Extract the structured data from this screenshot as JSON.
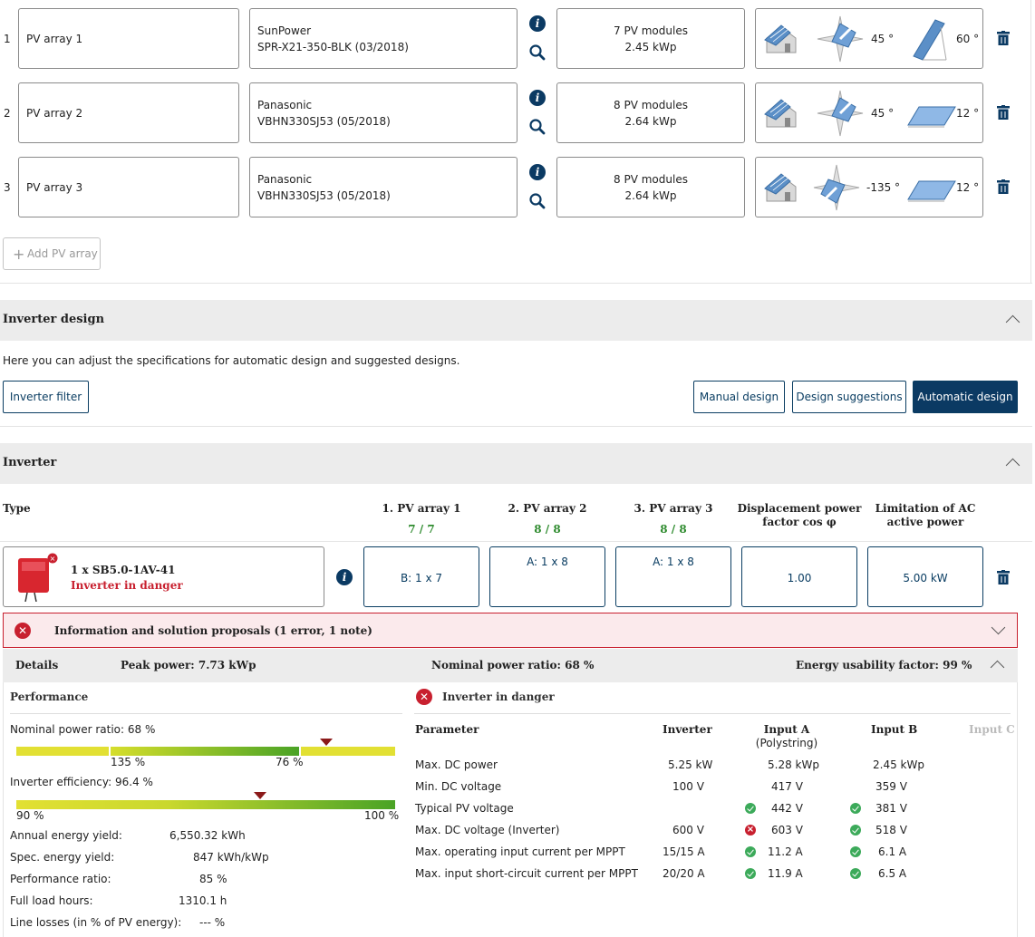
{
  "pv_arrays": [
    {
      "index": "1",
      "name": "PV array 1",
      "manufacturer": "SunPower",
      "model": "SPR-X21-350-BLK (03/2018)",
      "modules": "7 PV modules",
      "power": "2.45 kWp",
      "azimuth": "45 °",
      "tilt": "60 °"
    },
    {
      "index": "2",
      "name": "PV array 2",
      "manufacturer": "Panasonic",
      "model": "VBHN330SJ53 (05/2018)",
      "modules": "8 PV modules",
      "power": "2.64 kWp",
      "azimuth": "45 °",
      "tilt": "12 °"
    },
    {
      "index": "3",
      "name": "PV array 3",
      "manufacturer": "Panasonic",
      "model": "VBHN330SJ53 (05/2018)",
      "modules": "8 PV modules",
      "power": "2.64 kWp",
      "azimuth": "-135 °",
      "tilt": "12 °"
    }
  ],
  "add_pv_array_label": "Add PV array",
  "inverter_design": {
    "title": "Inverter design",
    "description": "Here you can adjust the specifications for automatic design and suggested designs.",
    "filter_label": "Inverter filter",
    "manual_label": "Manual design",
    "suggestions_label": "Design suggestions",
    "automatic_label": "Automatic design"
  },
  "inverter": {
    "title": "Inverter",
    "col_type": "Type",
    "col_pv1": "1. PV array 1",
    "col_pv2": "2. PV array 2",
    "col_pv3": "3. PV array 3",
    "pv1_count": "7 / 7",
    "pv2_count": "8 / 8",
    "pv3_count": "8 / 8",
    "col_cosphi_line1": "Displacement power",
    "col_cosphi_line2": "factor cos φ",
    "col_limit_line1": "Limitation of AC",
    "col_limit_line2": "active power",
    "model": "1 x SB5.0-1AV-41",
    "status": "Inverter in danger",
    "pv1_config": "B: 1 x 7",
    "pv2_config": "A: 1 x 8",
    "pv3_config": "A: 1 x 8",
    "cosphi": "1.00",
    "limit": "5.00 kW"
  },
  "info_panel": {
    "label": "Information and solution proposals (1 error, 1 note)"
  },
  "details": {
    "label": "Details",
    "peak_power": "Peak power: 7.73 kWp",
    "nominal_ratio": "Nominal power ratio: 68 %",
    "energy_usability": "Energy usability factor: 99 %"
  },
  "performance": {
    "title": "Performance",
    "nominal_ratio_label": "Nominal power ratio: 68 %",
    "bar1_left_tick": "135 %",
    "bar1_right_tick": "76 %",
    "efficiency_label": "Inverter efficiency: 96.4 %",
    "bar2_min": "90 %",
    "bar2_max": "100 %",
    "rows": [
      {
        "label": "Annual energy yield:",
        "value": "6,550.32 kWh"
      },
      {
        "label": "Spec. energy yield:",
        "value": "847 kWh/kWp"
      },
      {
        "label": "Performance ratio:",
        "value": "85 %"
      },
      {
        "label": "Full load hours:",
        "value": "1310.1 h"
      },
      {
        "label": "Line losses (in % of PV energy):",
        "value": "--- %"
      }
    ]
  },
  "danger_table": {
    "title": "Inverter in danger",
    "headers": {
      "parameter": "Parameter",
      "inverter": "Inverter",
      "input_a": "Input A",
      "input_a_sub": "(Polystring)",
      "input_b": "Input B",
      "input_c": "Input C"
    },
    "rows": [
      {
        "param": "Max. DC power",
        "inverter": "5.25 kW",
        "a": "5.28 kWp",
        "a_status": "",
        "b": "2.45 kWp",
        "b_status": ""
      },
      {
        "param": "Min. DC voltage",
        "inverter": "100 V",
        "a": "417 V",
        "a_status": "",
        "b": "359 V",
        "b_status": ""
      },
      {
        "param": "Typical PV voltage",
        "inverter": "",
        "a": "442 V",
        "a_status": "ok",
        "b": "381 V",
        "b_status": "ok"
      },
      {
        "param": "Max. DC voltage (Inverter)",
        "inverter": "600 V",
        "a": "603 V",
        "a_status": "error",
        "b": "518 V",
        "b_status": "ok"
      },
      {
        "param": "Max. operating input current per MPPT",
        "inverter": "15/15 A",
        "a": "11.2 A",
        "a_status": "ok",
        "b": "6.1 A",
        "b_status": "ok"
      },
      {
        "param": "Max. input short-circuit current per MPPT",
        "inverter": "20/20 A",
        "a": "11.9 A",
        "a_status": "ok",
        "b": "6.5 A",
        "b_status": "ok"
      }
    ]
  },
  "colors": {
    "primary": "#0b3a63",
    "ok": "#3caa5a",
    "error": "#c8202f",
    "error_bg": "#fbeaec",
    "section_bg": "#ececec"
  },
  "icons": [
    "info-icon",
    "search-icon",
    "trash-icon",
    "house-icon",
    "compass-icon",
    "tilted-panel-icon",
    "plus-icon",
    "chevron-up-icon",
    "chevron-down-icon",
    "error-icon",
    "ok-icon",
    "inverter-device-icon"
  ],
  "gauges": {
    "nominal_power_ratio_percent": 68,
    "inverter_efficiency_percent": 96.4
  }
}
